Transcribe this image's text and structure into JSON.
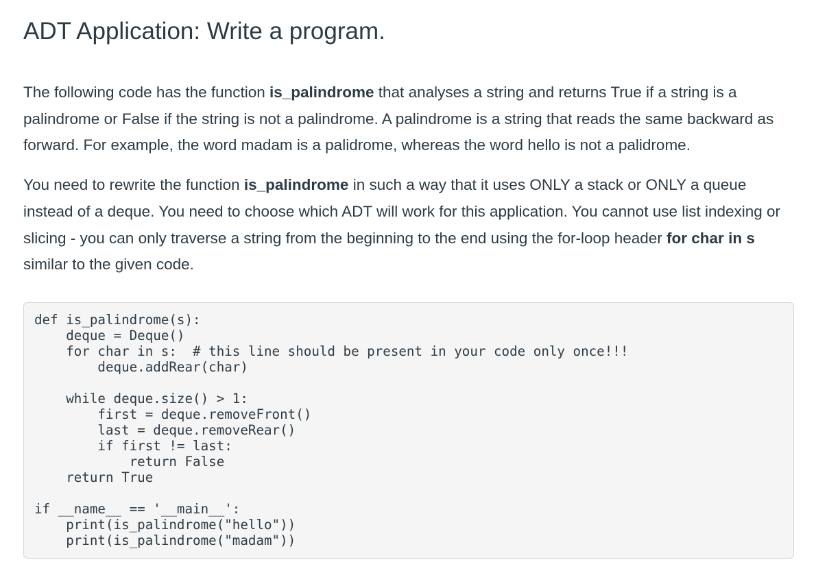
{
  "title": "ADT Application: Write a program.",
  "paragraph1": {
    "part1": "The following code has the function ",
    "bold1": "is_palindrome",
    "part2": " that analyses a string and returns True if a string is a palindrome or False if the string is not a palindrome. A palindrome is a string that reads the same backward as forward. For example, the word madam is a palidrome, whereas the word hello is not a palidrome."
  },
  "paragraph2": {
    "part1": "You need to rewrite the function ",
    "bold1": "is_palindrome",
    "part2": " in such a way that it uses ONLY a stack or ONLY a queue instead of a deque. You need to choose which ADT will work for this application. You cannot use list indexing or slicing - you can only traverse a string from the beginning to the end using the for-loop header ",
    "bold2": "for char in s",
    "part3": " similar to the given code."
  },
  "code_lines": [
    "def is_palindrome(s):",
    "    deque = Deque()",
    "    for char in s:  # this line should be present in your code only once!!!",
    "        deque.addRear(char)",
    "",
    "    while deque.size() > 1:",
    "        first = deque.removeFront()",
    "        last = deque.removeRear()",
    "        if first != last:",
    "            return False",
    "    return True",
    "",
    "if __name__ == '__main__':",
    "    print(is_palindrome(\"hello\"))",
    "    print(is_palindrome(\"madam\"))"
  ]
}
